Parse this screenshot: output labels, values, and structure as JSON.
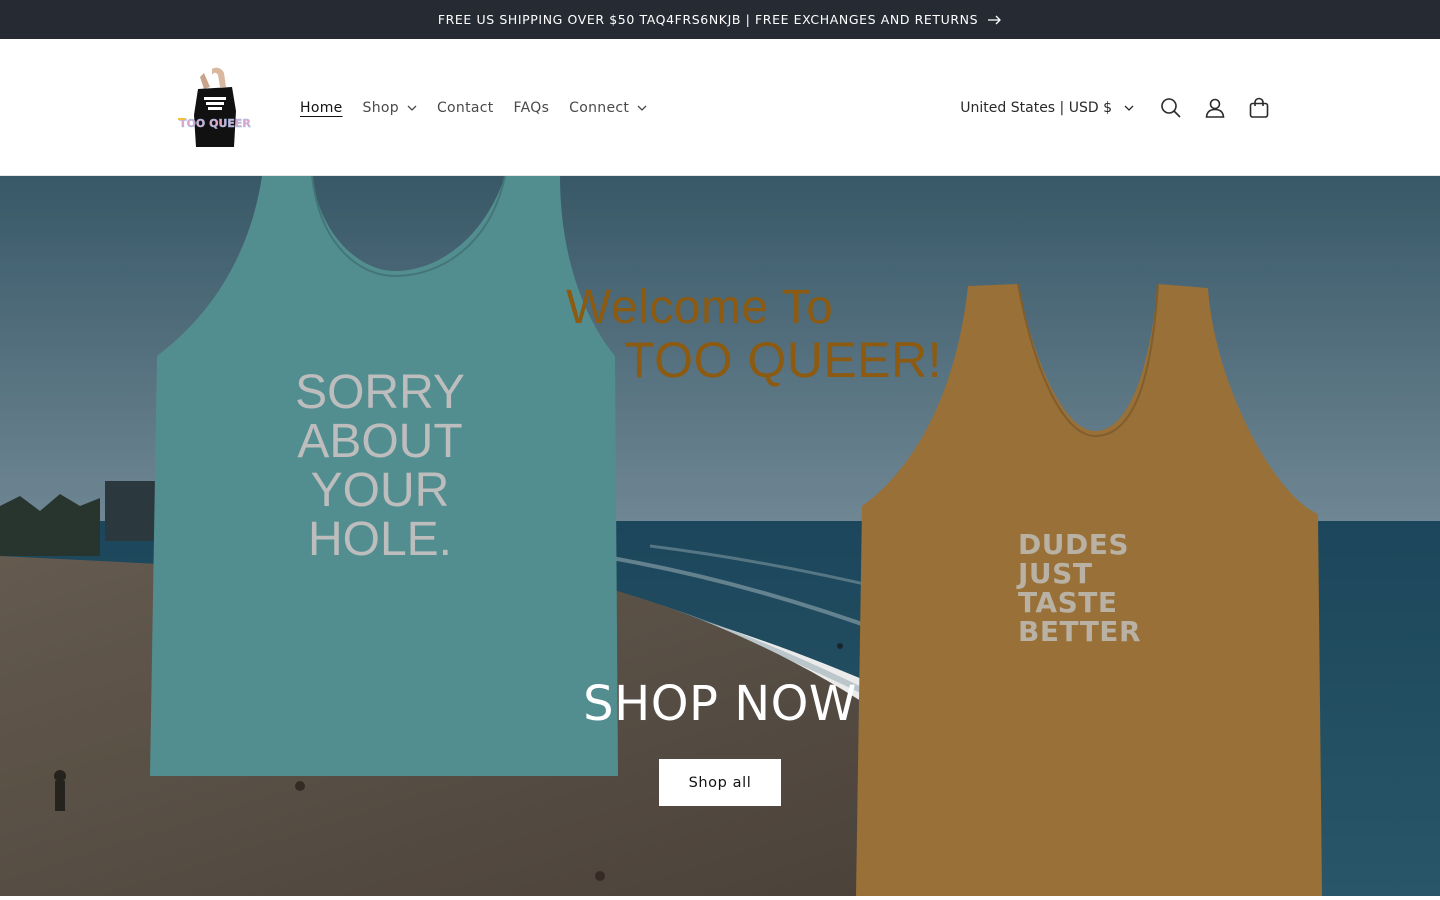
{
  "announcement": {
    "text": "FREE US SHIPPING OVER $50 TAQ4FRS6NKJB | FREE EXCHANGES AND RETURNS"
  },
  "logo": {
    "text": "TOO QUEER"
  },
  "nav": {
    "items": [
      {
        "label": "Home",
        "active": true,
        "dropdown": false
      },
      {
        "label": "Shop",
        "active": false,
        "dropdown": true
      },
      {
        "label": "Contact",
        "active": false,
        "dropdown": false
      },
      {
        "label": "FAQs",
        "active": false,
        "dropdown": false
      },
      {
        "label": "Connect",
        "active": false,
        "dropdown": true
      }
    ]
  },
  "header": {
    "country_selector": "United States | USD $",
    "icons": [
      "search-icon",
      "account-icon",
      "cart-icon"
    ]
  },
  "hero": {
    "welcome_line1": "Welcome To",
    "welcome_line2": "TOO QUEER!",
    "tank_left_text": [
      "SORRY",
      "ABOUT",
      "YOUR",
      "HOLE."
    ],
    "tank_right_text": [
      "DUDES",
      "JUST",
      "TASTE",
      "BETTER"
    ],
    "title": "SHOP NOW",
    "button_label": "Shop all"
  },
  "colors": {
    "announcement_bg": "#262a33",
    "tank_left": "#5b9c9e",
    "tank_right": "#a97c3e",
    "welcome_text": "#8c5a10"
  }
}
